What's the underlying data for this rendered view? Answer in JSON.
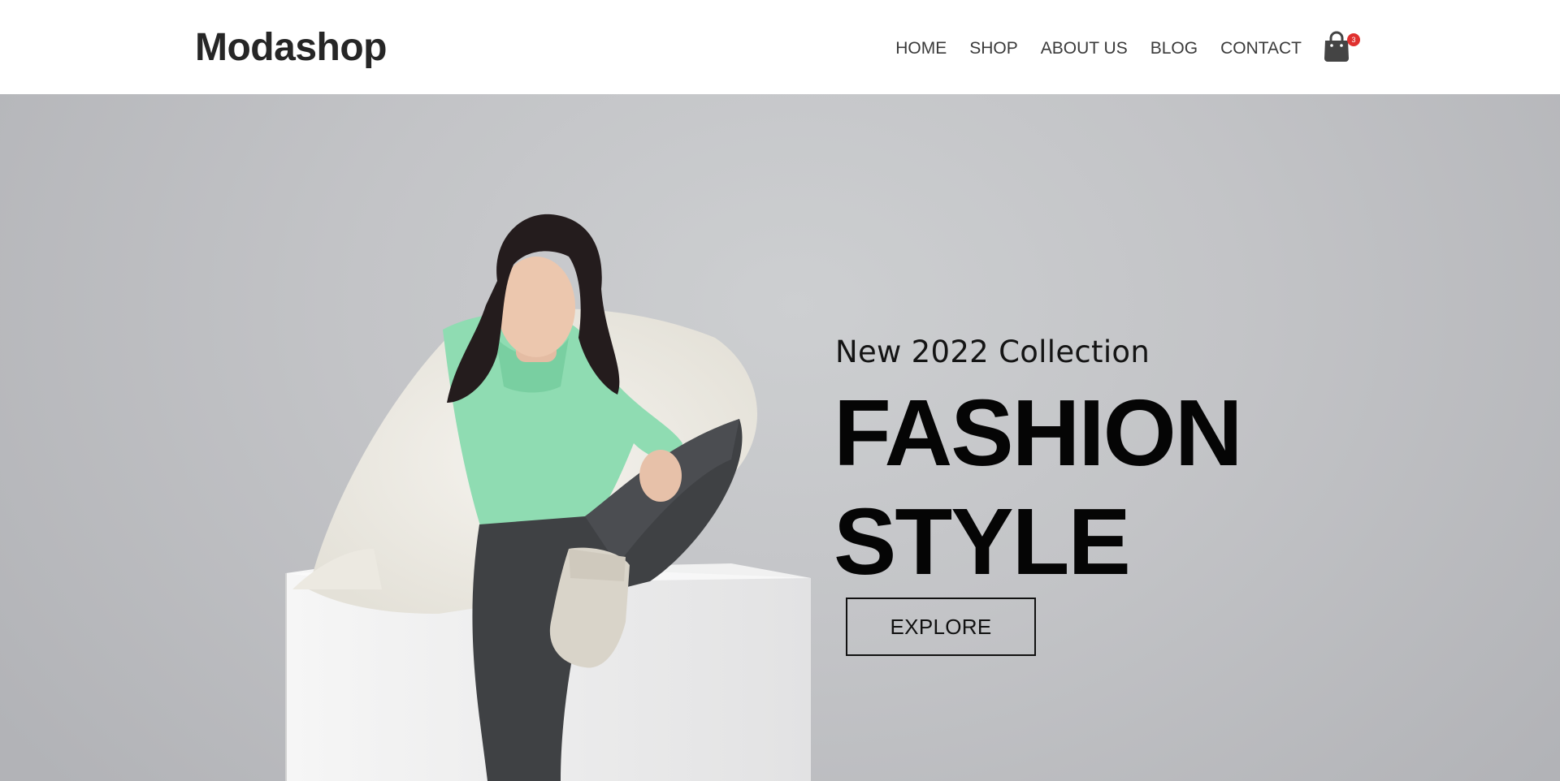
{
  "brand": {
    "name": "Modashop"
  },
  "nav": {
    "items": [
      {
        "label": "HOME"
      },
      {
        "label": "SHOP"
      },
      {
        "label": "ABOUT US"
      },
      {
        "label": "BLOG"
      },
      {
        "label": "CONTACT"
      }
    ],
    "cart": {
      "icon": "shopping-bag-icon",
      "count": "3"
    }
  },
  "hero": {
    "subtitle": "New 2022 Collection",
    "title_line1": "FASHION",
    "title_line2": "STYLE",
    "cta_label": "EXPLORE"
  },
  "colors": {
    "badge": "#e0312f",
    "text_dark": "#262626",
    "hero_bg": "#c3c4c7"
  }
}
